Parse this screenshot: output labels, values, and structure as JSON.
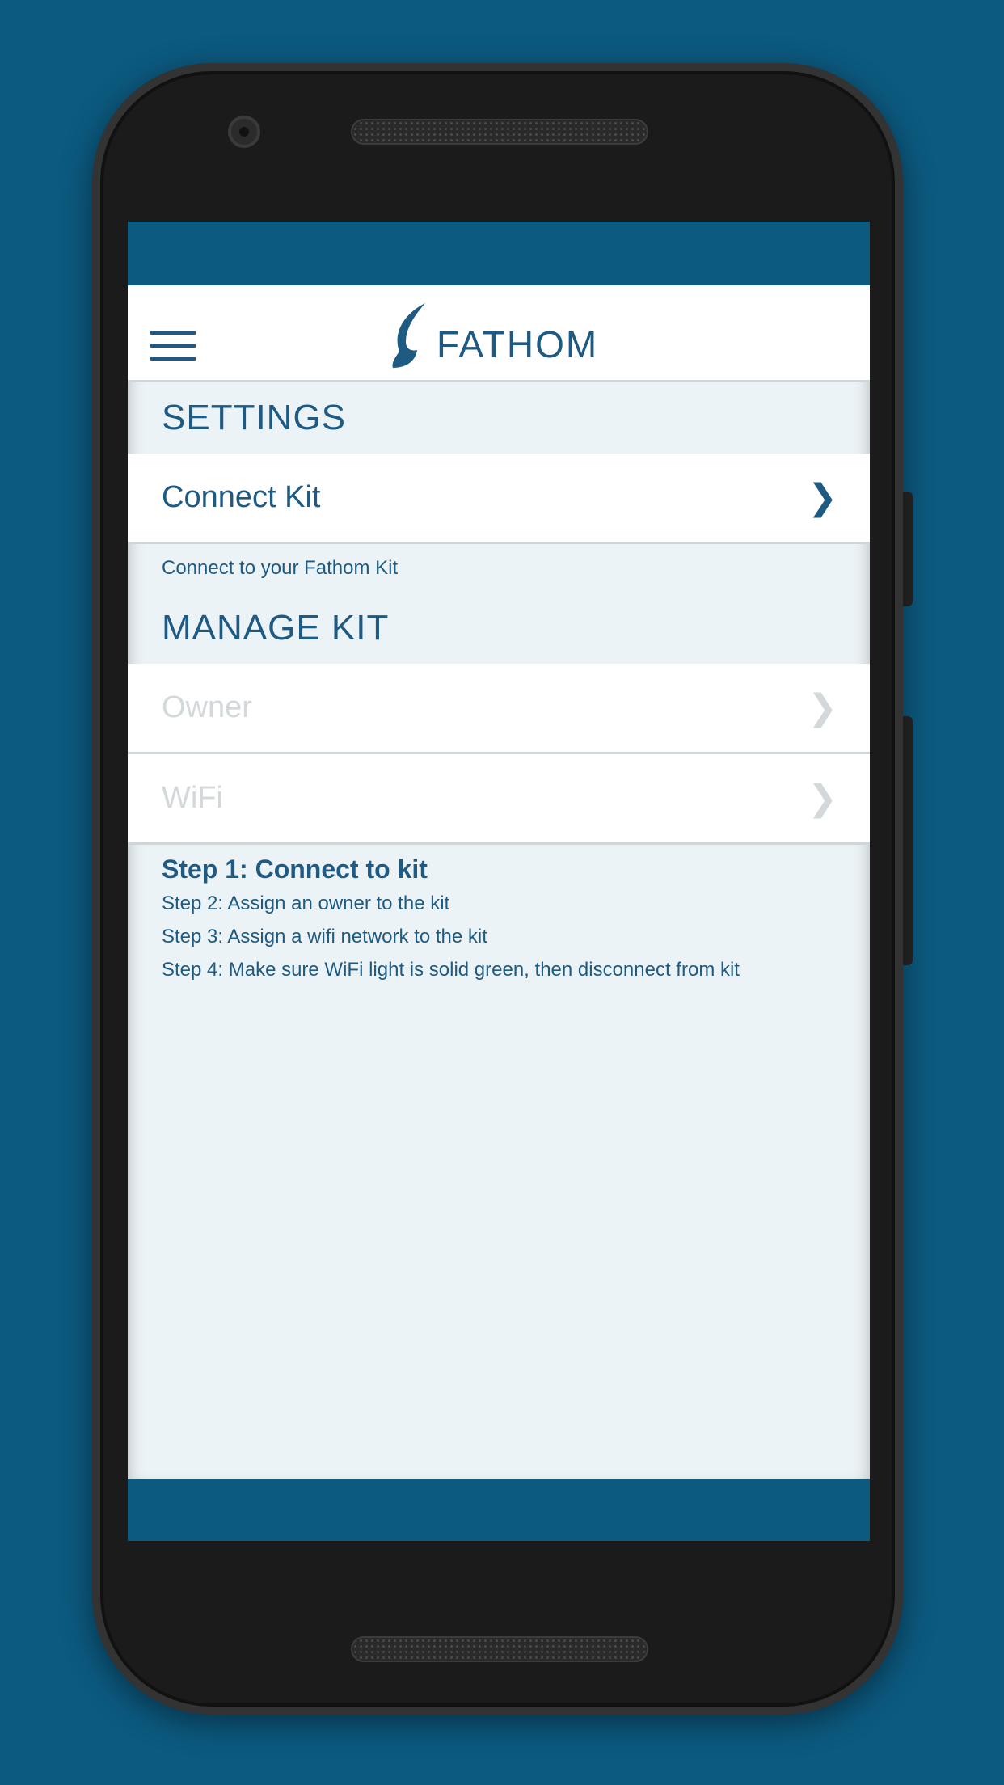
{
  "app": {
    "brand": "FATHOM"
  },
  "settings": {
    "heading": "SETTINGS",
    "connect_kit": {
      "label": "Connect Kit",
      "helper": "Connect to your Fathom Kit"
    }
  },
  "manage_kit": {
    "heading": "MANAGE KIT",
    "items": [
      {
        "label": "Owner",
        "enabled": false
      },
      {
        "label": "WiFi",
        "enabled": false
      }
    ]
  },
  "steps": [
    {
      "text": "Step 1: Connect to kit",
      "active": true
    },
    {
      "text": "Step 2: Assign an owner to the kit",
      "active": false
    },
    {
      "text": "Step 3: Assign a wifi network to the kit",
      "active": false
    },
    {
      "text": "Step 4: Make sure WiFi light is solid green, then disconnect from kit",
      "active": false
    }
  ],
  "icons": {
    "menu": "hamburger-menu-icon",
    "logo": "feather-logo-icon",
    "chevron": "chevron-right-icon"
  },
  "colors": {
    "primary": "#1f5a82",
    "background": "#0c5a80",
    "panel": "#ebf3f6",
    "disabled_text": "#d3d8db"
  }
}
